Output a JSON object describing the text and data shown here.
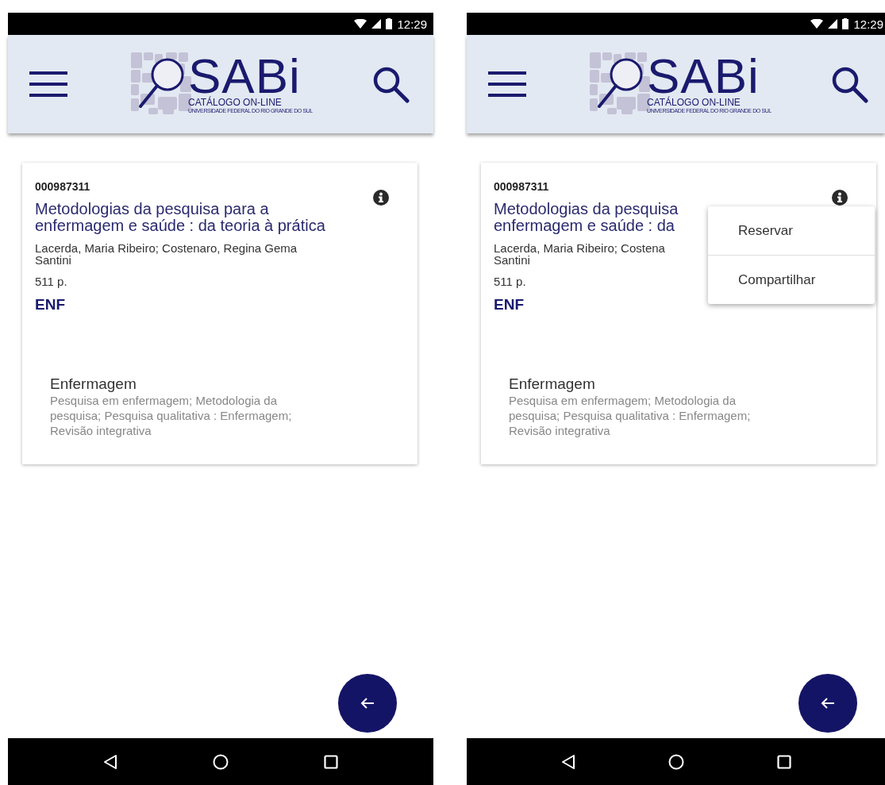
{
  "screens": [
    {
      "status_bar": {
        "time": "12:29"
      },
      "header": {
        "logo": {
          "name": "SABi",
          "subtitle": "CATÁLOGO ON-LINE",
          "tagline": "UNIVERSIDADE FEDERAL DO RIO GRANDE DO SUL"
        }
      },
      "card": {
        "id": "000987311",
        "title_lines": [
          "Metodologias da pesquisa para a",
          "enfermagem e saúde : da teoria à prática"
        ],
        "author_lines": [
          "Lacerda, Maria Ribeiro; Costenaro, Regina Gema",
          "Santini"
        ],
        "pages": "511 p.",
        "collection": "ENF",
        "subject_heading": "Enfermagem",
        "subjects": "Pesquisa em enfermagem; Metodologia da pesquisa; Pesquisa qualitativa : Enfermagem; Revisão integrativa"
      }
    },
    {
      "status_bar": {
        "time": "12:29"
      },
      "header": {
        "logo": {
          "name": "SABi",
          "subtitle": "CATÁLOGO ON-LINE",
          "tagline": "UNIVERSIDADE FEDERAL DO RIO GRANDE DO SUL"
        }
      },
      "card": {
        "id": "000987311",
        "title_lines": [
          "Metodologias da pesquisa",
          "enfermagem e saúde : da"
        ],
        "author_lines": [
          "Lacerda, Maria Ribeiro; Costena",
          "Santini"
        ],
        "pages": "511 p.",
        "collection": "ENF",
        "subject_heading": "Enfermagem",
        "subjects": "Pesquisa em enfermagem; Metodologia da pesquisa; Pesquisa qualitativa : Enfermagem; Revisão integrativa"
      },
      "menu": {
        "items": [
          "Reservar",
          "Compartilhar"
        ]
      }
    }
  ]
}
